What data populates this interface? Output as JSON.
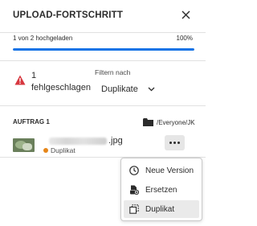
{
  "header": {
    "title": "UPLOAD-FORTSCHRITT",
    "close_icon": "close-icon"
  },
  "progress": {
    "text": "1 von 2 hochgeladen",
    "percent_label": "100%",
    "fraction": 1.0,
    "color": "#1473e6"
  },
  "summary": {
    "failed_count": "1",
    "failed_label": "fehlgeschlagen",
    "alert_color": "#d7373f"
  },
  "filter": {
    "label": "Filtern nach",
    "selected": "Duplikate"
  },
  "job": {
    "label": "AUFTRAG 1",
    "path": "/Everyone/JK"
  },
  "file": {
    "extension": ".jpg",
    "status": "Duplikat",
    "status_color": "#e68619"
  },
  "menu": {
    "items": [
      {
        "label": "Neue Version",
        "icon": "clock-icon"
      },
      {
        "label": "Ersetzen",
        "icon": "replace-icon"
      },
      {
        "label": "Duplikat",
        "icon": "duplicate-icon"
      }
    ],
    "active_index": 2
  }
}
